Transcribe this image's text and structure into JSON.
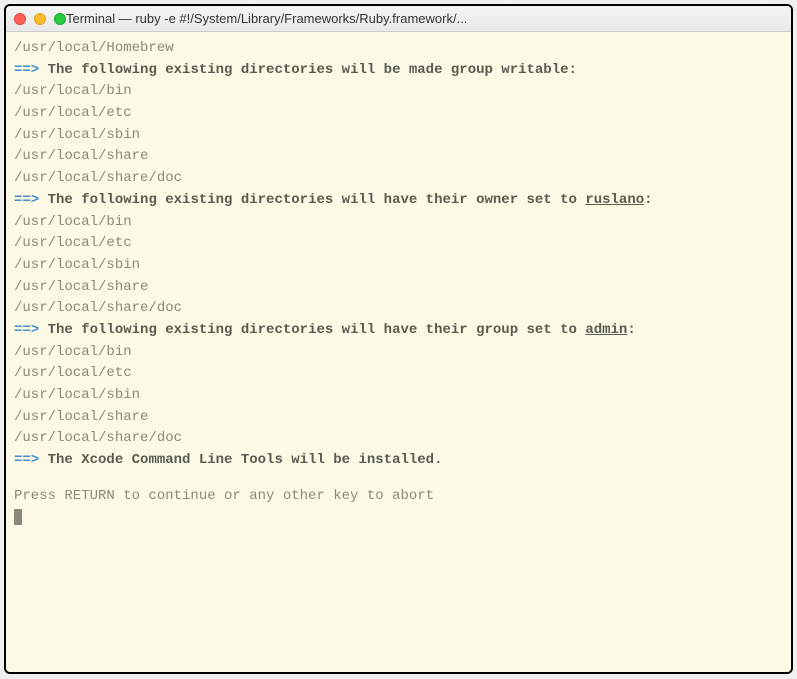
{
  "window": {
    "title": "Terminal — ruby -e #!/System/Library/Frameworks/Ruby.framework/..."
  },
  "terminal": {
    "line_homebrew": "/usr/local/Homebrew",
    "arrow": "==>",
    "msg_writable": "The following existing directories will be made group writable:",
    "dirs1": [
      "/usr/local/bin",
      "/usr/local/etc",
      "/usr/local/sbin",
      "/usr/local/share",
      "/usr/local/share/doc"
    ],
    "msg_owner_pre": "The following existing directories will have their owner set to ",
    "owner": "ruslano",
    "colon": ":",
    "dirs2": [
      "/usr/local/bin",
      "/usr/local/etc",
      "/usr/local/sbin",
      "/usr/local/share",
      "/usr/local/share/doc"
    ],
    "msg_group_pre": "The following existing directories will have their group set to ",
    "group": "admin",
    "dirs3": [
      "/usr/local/bin",
      "/usr/local/etc",
      "/usr/local/sbin",
      "/usr/local/share",
      "/usr/local/share/doc"
    ],
    "msg_xcode": "The Xcode Command Line Tools will be installed.",
    "prompt": "Press RETURN to continue or any other key to abort"
  },
  "watermark": ""
}
